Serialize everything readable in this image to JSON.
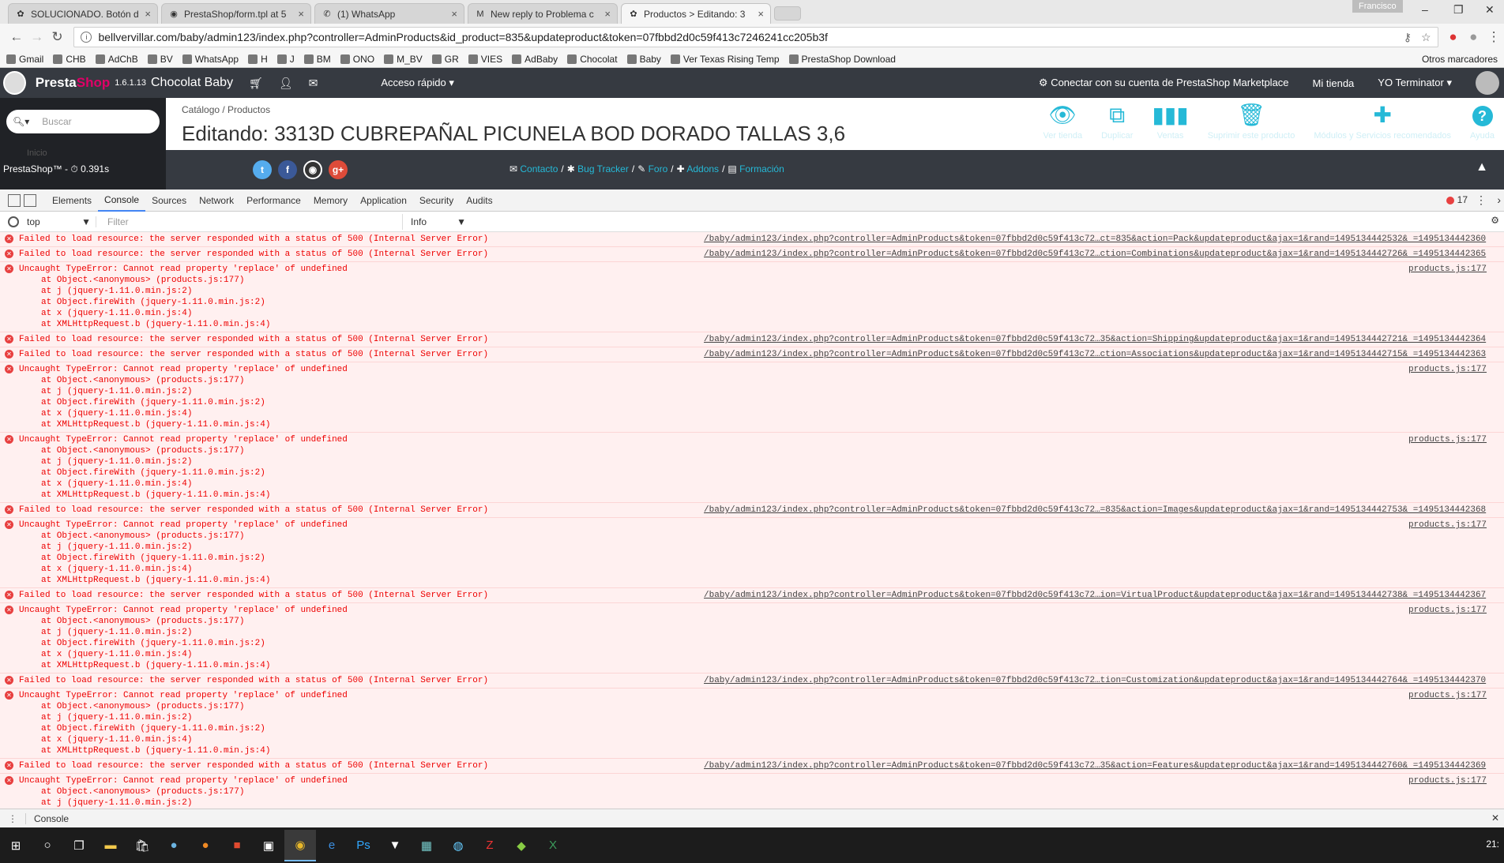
{
  "browser": {
    "tabs": [
      {
        "title": "SOLUCIONADO. Botón d",
        "icon": "prestashop-icon",
        "active": false
      },
      {
        "title": "PrestaShop/form.tpl at 5",
        "icon": "github-icon",
        "active": false
      },
      {
        "title": "(1) WhatsApp",
        "icon": "whatsapp-icon",
        "active": false
      },
      {
        "title": "New reply to Problema c",
        "icon": "gmail-icon",
        "active": false
      },
      {
        "title": "Productos > Editando: 3",
        "icon": "prestashop-icon",
        "active": true
      }
    ],
    "window_user": "Francisco",
    "url": "bellvervillar.com/baby/admin123/index.php?controller=AdminProducts&id_product=835&updateproduct&token=07fbbd2d0c59f413c7246241cc205b3f",
    "bookmarks": [
      "Gmail",
      "CHB",
      "AdChB",
      "BV",
      "WhatsApp",
      "H",
      "J",
      "BM",
      "ONO",
      "M_BV",
      "GR",
      "VIES",
      "AdBaby",
      "Chocolat",
      "Baby",
      "Ver Texas Rising Temp",
      "PrestaShop Download"
    ],
    "bookmarks_other": "Otros marcadores"
  },
  "ps": {
    "logo_a": "Presta",
    "logo_b": "Shop",
    "version": "1.6.1.13",
    "shop": "Chocolat Baby",
    "quick": "Acceso rápido",
    "connect": "Conectar con su cuenta de PrestaShop Marketplace",
    "mystore": "Mi tienda",
    "user": "YO Terminator",
    "search_placeholder": "Buscar",
    "perf": "PrestaShop™ - ⏱ 0.391s",
    "side_faint": "Inicio",
    "breadcrumb": "Catálogo  /  Productos",
    "title": "Editando: 3313D CUBREPAÑAL PICUNELA BOD DORADO TALLAS 3,6",
    "toolbar": [
      {
        "label": "Ver tienda",
        "icon": "eye-icon"
      },
      {
        "label": "Duplicar",
        "icon": "duplicate-icon"
      },
      {
        "label": "Ventas",
        "icon": "bar-chart-icon"
      },
      {
        "label": "Suprimir este producto",
        "icon": "trash-icon"
      },
      {
        "label": "Módulos y Servicios recomendados",
        "icon": "puzzle-icon"
      },
      {
        "label": "Ayuda",
        "icon": "help-icon"
      }
    ],
    "footer_links": [
      "Contacto",
      "Bug Tracker",
      "Foro",
      "Addons",
      "Formación"
    ]
  },
  "devtools": {
    "tabs": [
      "Elements",
      "Console",
      "Sources",
      "Network",
      "Performance",
      "Memory",
      "Application",
      "Security",
      "Audits"
    ],
    "active_tab": "Console",
    "error_count": "17",
    "context": "top",
    "filter_placeholder": "Filter",
    "level": "Info",
    "drawer_tab": "Console"
  },
  "console": {
    "messages": [
      {
        "type": "fail",
        "text": "Failed to load resource: the server responded with a status of 500 (Internal Server Error)",
        "src": "/baby/admin123/index.php?controller=AdminProducts&token=07fbbd2d0c59f413c72…ct=835&action=Pack&updateproduct&ajax=1&rand=1495134442532& =1495134442360"
      },
      {
        "type": "fail",
        "text": "Failed to load resource: the server responded with a status of 500 (Internal Server Error)",
        "src": "/baby/admin123/index.php?controller=AdminProducts&token=07fbbd2d0c59f413c72…ction=Combinations&updateproduct&ajax=1&rand=1495134442726& =1495134442365"
      },
      {
        "type": "type",
        "text": "Uncaught TypeError: Cannot read property 'replace' of undefined",
        "src": "products.js:177",
        "stack": [
          "at Object.<anonymous> (products.js:177)",
          "at j (jquery-1.11.0.min.js:2)",
          "at Object.fireWith (jquery-1.11.0.min.js:2)",
          "at x (jquery-1.11.0.min.js:4)",
          "at XMLHttpRequest.b (jquery-1.11.0.min.js:4)"
        ]
      },
      {
        "type": "fail",
        "text": "Failed to load resource: the server responded with a status of 500 (Internal Server Error)",
        "src": "/baby/admin123/index.php?controller=AdminProducts&token=07fbbd2d0c59f413c72…35&action=Shipping&updateproduct&ajax=1&rand=1495134442721& =1495134442364"
      },
      {
        "type": "fail",
        "text": "Failed to load resource: the server responded with a status of 500 (Internal Server Error)",
        "src": "/baby/admin123/index.php?controller=AdminProducts&token=07fbbd2d0c59f413c72…ction=Associations&updateproduct&ajax=1&rand=1495134442715& =1495134442363"
      },
      {
        "type": "type",
        "text": "Uncaught TypeError: Cannot read property 'replace' of undefined",
        "src": "products.js:177",
        "stack": [
          "at Object.<anonymous> (products.js:177)",
          "at j (jquery-1.11.0.min.js:2)",
          "at Object.fireWith (jquery-1.11.0.min.js:2)",
          "at x (jquery-1.11.0.min.js:4)",
          "at XMLHttpRequest.b (jquery-1.11.0.min.js:4)"
        ]
      },
      {
        "type": "type",
        "text": "Uncaught TypeError: Cannot read property 'replace' of undefined",
        "src": "products.js:177",
        "stack": [
          "at Object.<anonymous> (products.js:177)",
          "at j (jquery-1.11.0.min.js:2)",
          "at Object.fireWith (jquery-1.11.0.min.js:2)",
          "at x (jquery-1.11.0.min.js:4)",
          "at XMLHttpRequest.b (jquery-1.11.0.min.js:4)"
        ]
      },
      {
        "type": "fail",
        "text": "Failed to load resource: the server responded with a status of 500 (Internal Server Error)",
        "src": "/baby/admin123/index.php?controller=AdminProducts&token=07fbbd2d0c59f413c72…=835&action=Images&updateproduct&ajax=1&rand=1495134442753& =1495134442368"
      },
      {
        "type": "type",
        "text": "Uncaught TypeError: Cannot read property 'replace' of undefined",
        "src": "products.js:177",
        "stack": [
          "at Object.<anonymous> (products.js:177)",
          "at j (jquery-1.11.0.min.js:2)",
          "at Object.fireWith (jquery-1.11.0.min.js:2)",
          "at x (jquery-1.11.0.min.js:4)",
          "at XMLHttpRequest.b (jquery-1.11.0.min.js:4)"
        ]
      },
      {
        "type": "fail",
        "text": "Failed to load resource: the server responded with a status of 500 (Internal Server Error)",
        "src": "/baby/admin123/index.php?controller=AdminProducts&token=07fbbd2d0c59f413c72…ion=VirtualProduct&updateproduct&ajax=1&rand=1495134442738& =1495134442367"
      },
      {
        "type": "type",
        "text": "Uncaught TypeError: Cannot read property 'replace' of undefined",
        "src": "products.js:177",
        "stack": [
          "at Object.<anonymous> (products.js:177)",
          "at j (jquery-1.11.0.min.js:2)",
          "at Object.fireWith (jquery-1.11.0.min.js:2)",
          "at x (jquery-1.11.0.min.js:4)",
          "at XMLHttpRequest.b (jquery-1.11.0.min.js:4)"
        ]
      },
      {
        "type": "fail",
        "text": "Failed to load resource: the server responded with a status of 500 (Internal Server Error)",
        "src": "/baby/admin123/index.php?controller=AdminProducts&token=07fbbd2d0c59f413c72…tion=Customization&updateproduct&ajax=1&rand=1495134442764& =1495134442370"
      },
      {
        "type": "type",
        "text": "Uncaught TypeError: Cannot read property 'replace' of undefined",
        "src": "products.js:177",
        "stack": [
          "at Object.<anonymous> (products.js:177)",
          "at j (jquery-1.11.0.min.js:2)",
          "at Object.fireWith (jquery-1.11.0.min.js:2)",
          "at x (jquery-1.11.0.min.js:4)",
          "at XMLHttpRequest.b (jquery-1.11.0.min.js:4)"
        ]
      },
      {
        "type": "fail",
        "text": "Failed to load resource: the server responded with a status of 500 (Internal Server Error)",
        "src": "/baby/admin123/index.php?controller=AdminProducts&token=07fbbd2d0c59f413c72…35&action=Features&updateproduct&ajax=1&rand=1495134442760& =1495134442369"
      },
      {
        "type": "type",
        "text": "Uncaught TypeError: Cannot read property 'replace' of undefined",
        "src": "products.js:177",
        "stack": [
          "at Object.<anonymous> (products.js:177)",
          "at j (jquery-1.11.0.min.js:2)"
        ]
      }
    ]
  },
  "taskbar": {
    "clock": "21:"
  },
  "colors": {
    "ps_dark": "#363a41",
    "ps_accent": "#25b9d7",
    "ps_pink": "#df0067",
    "error_red": "#e00",
    "error_bg": "#fff0f0"
  }
}
